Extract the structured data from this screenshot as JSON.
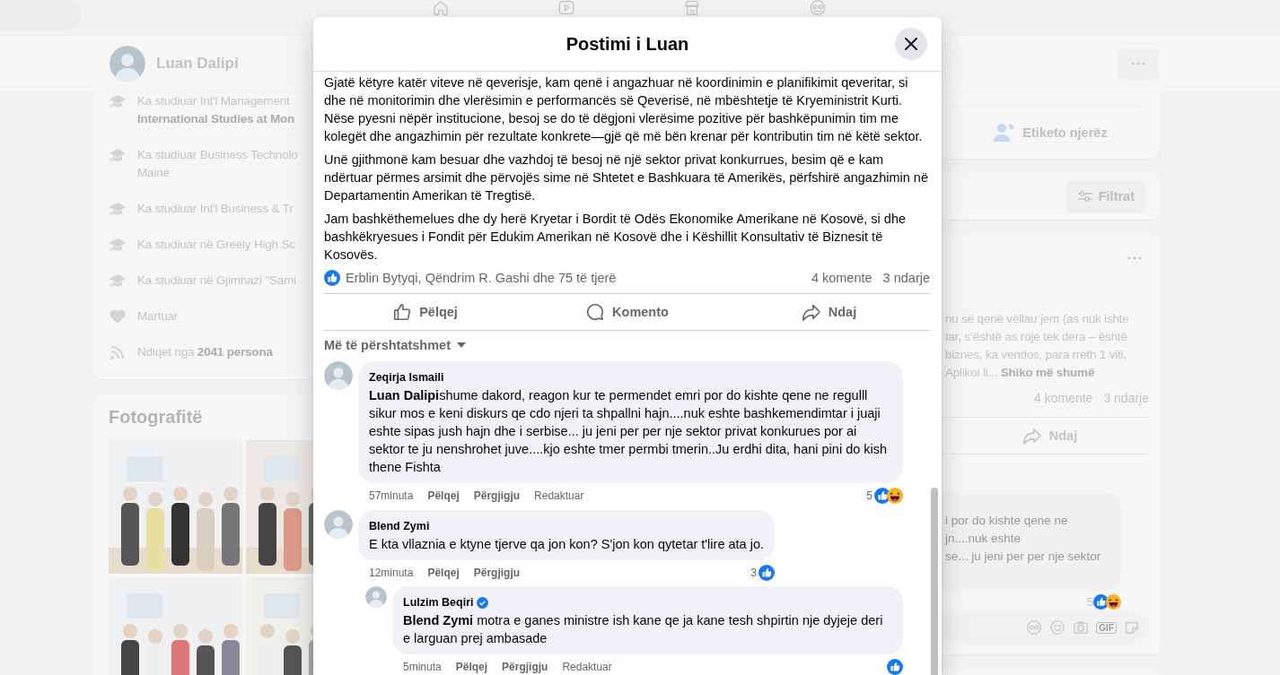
{
  "profile_header": {
    "name": "Luan Dalipi"
  },
  "intro": {
    "items": [
      {
        "kind": "education",
        "lines": [
          "Ka studiuar Int'l Management",
          "**International Studies at Mon**"
        ]
      },
      {
        "kind": "education",
        "lines": [
          "Ka studiuar Business Technolo",
          "Maine"
        ]
      },
      {
        "kind": "education",
        "lines": [
          "Ka studiuar Int'l Business & Tr"
        ]
      },
      {
        "kind": "education",
        "lines": [
          "Ka studiuar në Greely High Sc"
        ]
      },
      {
        "kind": "education",
        "lines": [
          "Ka studiuar në Gjimnazi \"Sami"
        ]
      },
      {
        "kind": "relationship",
        "lines": [
          "Martuar"
        ]
      },
      {
        "kind": "followers",
        "lines": [
          "Ndiqet nga **2041 persona**"
        ]
      }
    ]
  },
  "photos": {
    "title": "Fotografitë"
  },
  "right_column": {
    "tag_button": "Etiketo njerëz",
    "filter_button": "Filtrat",
    "post": {
      "text_lines": [
        "nu së qenë vëllau jem (as nuk ishte",
        "tar, s’është as roje tek dera – është",
        "biznes, ka vendos, para rreth 1 viti,",
        "Aplikoi li..."
      ],
      "see_more": "Shiko më shumë",
      "comments_count": "4 komente",
      "shares_count": "3 ndarje",
      "share_action": "Ndaj",
      "comment": {
        "text_lines": [
          "i por do kishte qene ne",
          "jn....nuk eshte",
          "se... ju jeni per per nje sektor"
        ],
        "reaction_count": "5",
        "reactions": [
          {
            "kind": "like"
          },
          {
            "kind": "haha"
          }
        ]
      },
      "gif_label": "GIF"
    }
  },
  "modal": {
    "title": "Postimi i Luan",
    "paragraphs": [
      "Gjatë këtyre katër viteve në qeverisje, kam qenë i angazhuar në koordinimin e planifikimit qeveritar, si dhe në monitorimin dhe vlerësimin e performancës së Qeverisë, në mbështetje të Kryeministrit Kurti. Nëse pyesni nëpër institucione, besoj se do të dëgjoni vlerësime pozitive për bashkëpunimin tim me kolegët dhe angazhimin për rezultate konkrete—gjë që më bën krenar për kontributin tim në këtë sektor.",
      "Unë gjithmonë kam besuar dhe vazhdoj të besoj në një sektor privat konkurrues, besim që e kam ndërtuar përmes arsimit dhe përvojës sime në Shtetet e Bashkuara të Amerikës, përfshirë angazhimin në Departamentin Amerikan të Tregtisë.",
      "Jam bashkëthemelues dhe dy herë Kryetar i Bordit të Odës Ekonomike Amerikane në Kosovë, si dhe bashkëkryesues i Fondit për Edukim Amerikan në Kosovë dhe i Këshillit Konsultativ të Biznesit të Kosovës."
    ],
    "reactions": {
      "kinds": [
        {
          "kind": "like"
        }
      ],
      "names": "Erblin Bytyqi, Qëndrim R. Gashi dhe 75 të tjerë",
      "comments_count": "4 komente",
      "shares_count": "3 ndarje"
    },
    "actions": [
      {
        "kind": "like",
        "label": "Pëlqej"
      },
      {
        "kind": "comment",
        "label": "Komento"
      },
      {
        "kind": "share",
        "label": "Ndaj"
      }
    ],
    "sort": "Më të përshtatshmet",
    "comments": [
      {
        "author": "Zeqirja Ismaili",
        "verified": false,
        "text": "**Luan Dalipi**shume dakord, reagon kur te permendet emri por do kishte qene ne regulll sikur mos e keni diskurs qe cdo njeri ta shpallni hajn....nuk eshte bashkemendimtar i juaji eshte sipas jush hajn dhe i serbise... ju jeni per per nje sektor privat konkurues por ai sektor te ju nenshrohet juve....kjo eshte tmer permbi tmerin..Ju erdhi dita, hani pini do kish thene Fishta",
        "time": "57minuta",
        "actions": [
          "Pëlqej",
          "Përgjigju"
        ],
        "edited": "Redaktuar",
        "reaction_count": "5",
        "reactions": [
          {
            "kind": "like"
          },
          {
            "kind": "haha"
          }
        ]
      },
      {
        "author": "Blend Zymi",
        "verified": false,
        "text": "E kta vllaznia e ktyne tjerve qa jon kon? S'jon kon qytetar t'lire ata jo.",
        "time": "12minuta",
        "actions": [
          "Pëlqej",
          "Përgjigju"
        ],
        "reaction_count": "3",
        "reactions": [
          {
            "kind": "like"
          }
        ],
        "replies": [
          {
            "author": "Lulzim Beqiri",
            "verified": true,
            "text": "**Blend Zymi** motra e ganes ministre ish kane qe ja kane tesh shpirtin nje dyjeje deri e larguan prej ambasade",
            "time": "5minuta",
            "actions": [
              "Pëlqej",
              "Përgjigju"
            ],
            "edited": "Redaktuar",
            "reactions": [
              {
                "kind": "like"
              }
            ]
          }
        ]
      }
    ]
  }
}
